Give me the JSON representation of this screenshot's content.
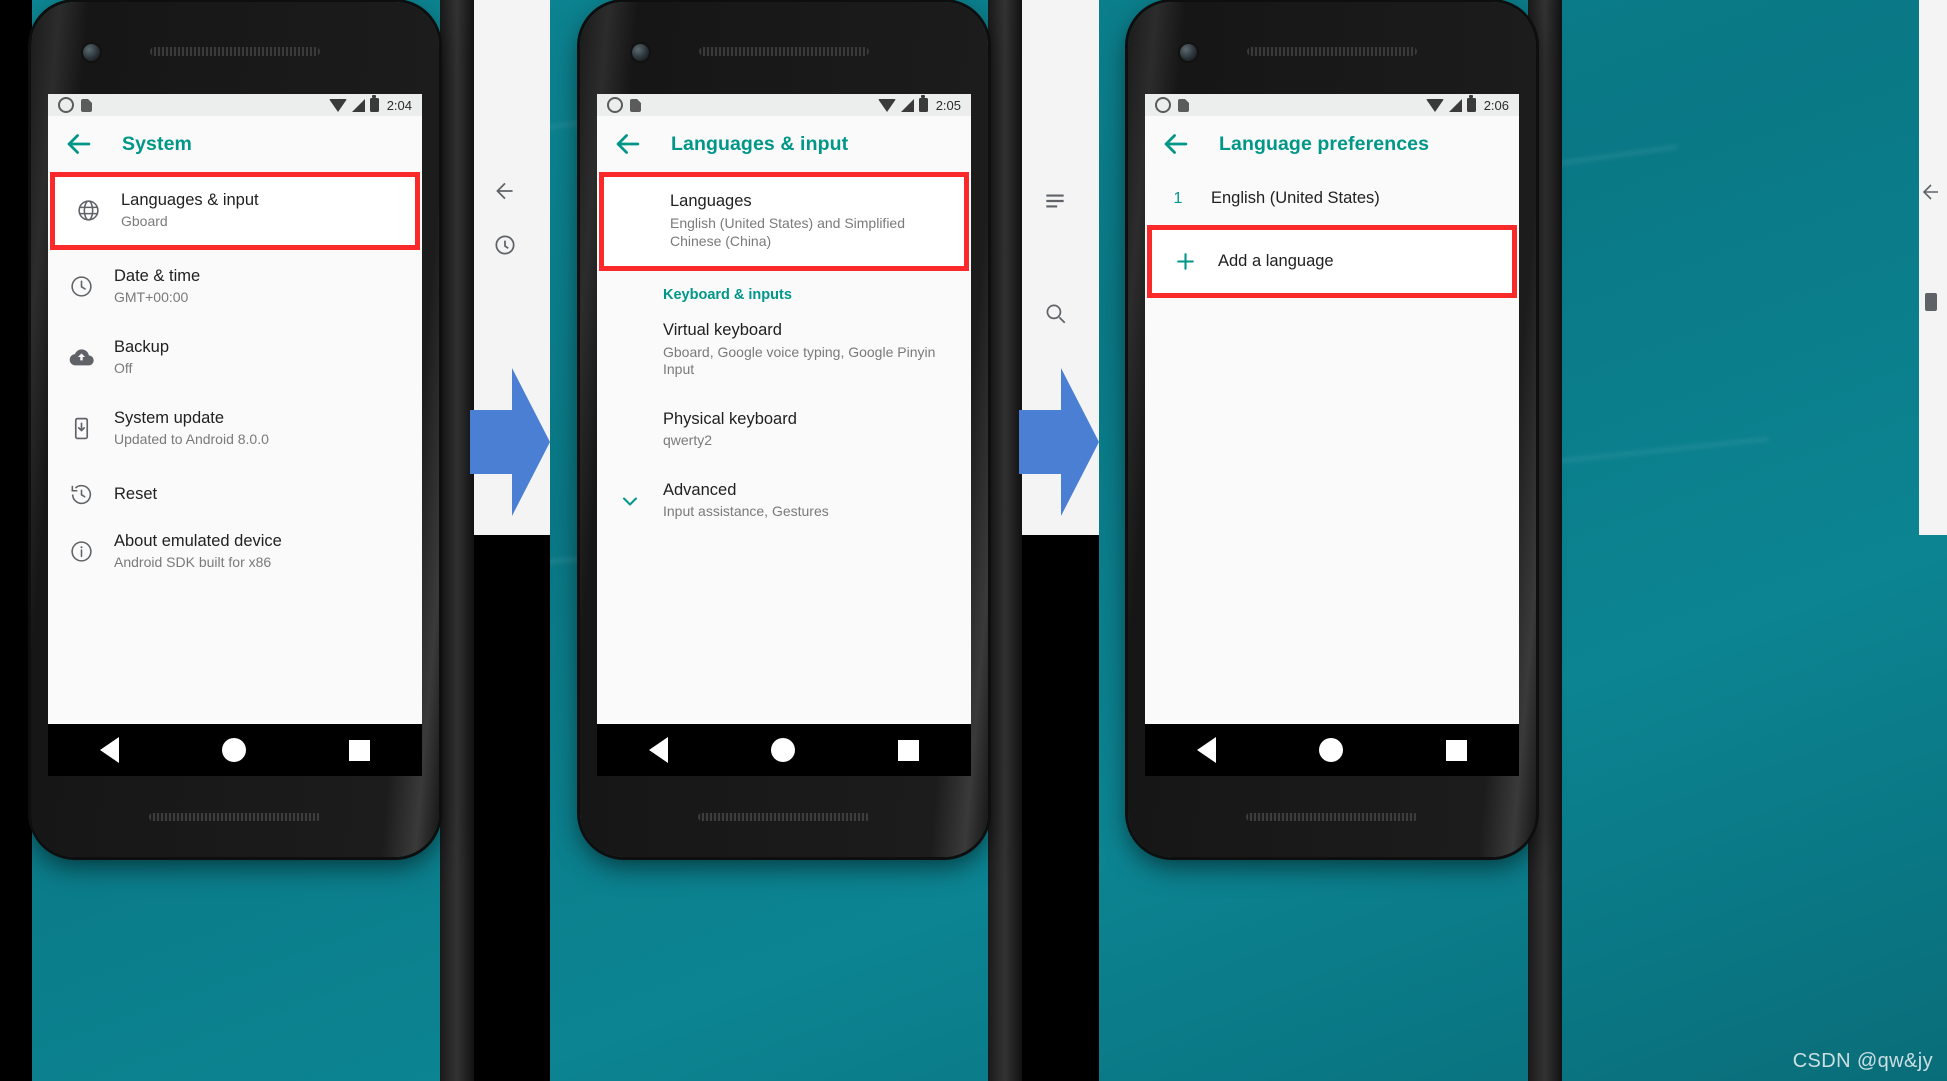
{
  "watermark": "CSDN @qw&jy",
  "phones": [
    {
      "id": "phone-system",
      "status": {
        "time": "2:04"
      },
      "appbar": {
        "title": "System",
        "back_icon": "back-arrow-icon"
      },
      "rows": [
        {
          "icon": "globe-icon",
          "title": "Languages & input",
          "sub": "Gboard",
          "highlighted": true
        },
        {
          "icon": "clock-icon",
          "title": "Date & time",
          "sub": "GMT+00:00",
          "highlighted": false
        },
        {
          "icon": "cloud-upload-icon",
          "title": "Backup",
          "sub": "Off",
          "highlighted": false
        },
        {
          "icon": "system-update-icon",
          "title": "System update",
          "sub": "Updated to Android 8.0.0",
          "highlighted": false
        },
        {
          "icon": "reset-icon",
          "title": "Reset",
          "sub": "",
          "highlighted": false
        },
        {
          "icon": "info-icon",
          "title": "About emulated device",
          "sub": "Android SDK built for x86",
          "highlighted": false
        }
      ]
    },
    {
      "id": "phone-languages-input",
      "status": {
        "time": "2:05"
      },
      "appbar": {
        "title": "Languages & input",
        "back_icon": "back-arrow-icon"
      },
      "rows": [
        {
          "icon": "none",
          "title": "Languages",
          "sub": "English (United States) and Simplified Chinese (China)",
          "highlighted": true
        },
        {
          "type": "section",
          "title": "Keyboard & inputs"
        },
        {
          "icon": "none",
          "title": "Virtual keyboard",
          "sub": "Gboard, Google voice typing, Google Pinyin Input",
          "highlighted": false
        },
        {
          "icon": "none",
          "title": "Physical keyboard",
          "sub": "qwerty2",
          "highlighted": false
        },
        {
          "icon": "chevron-down-icon",
          "title": "Advanced",
          "sub": "Input assistance, Gestures",
          "highlighted": false
        }
      ]
    },
    {
      "id": "phone-language-preferences",
      "status": {
        "time": "2:06"
      },
      "appbar": {
        "title": "Language preferences",
        "back_icon": "back-arrow-icon"
      },
      "rows": [
        {
          "index": "1",
          "title": "English (United States)",
          "sub": "",
          "highlighted": false
        },
        {
          "icon": "plus-icon",
          "title": "Add a language",
          "sub": "",
          "highlighted": true
        }
      ]
    }
  ],
  "colors": {
    "accent_teal": "#009688",
    "highlight_red": "#fb2a2a",
    "arrow_blue": "#4a7fd4",
    "wallpaper": "#0c7f8c"
  }
}
